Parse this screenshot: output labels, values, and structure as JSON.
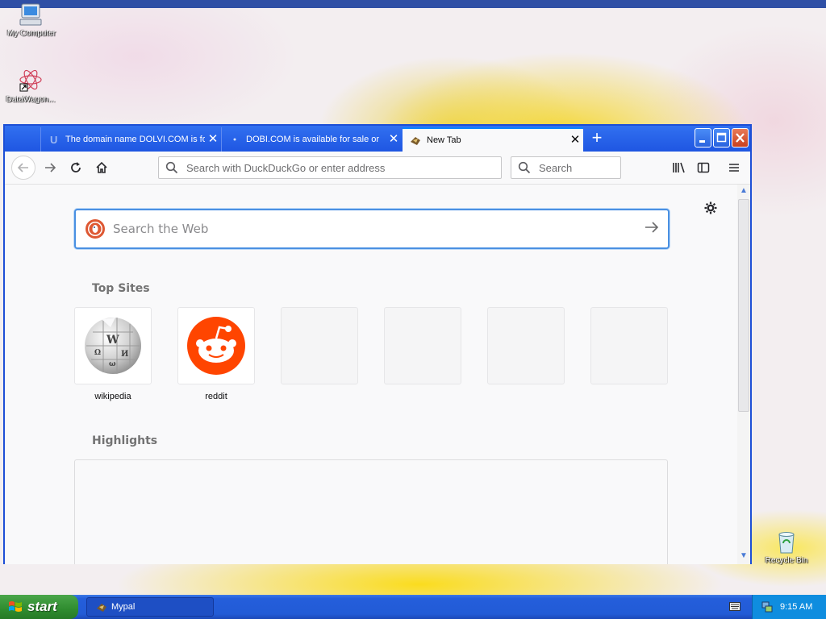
{
  "desktop": {
    "icons": [
      {
        "label": "My Computer",
        "icon": "my-computer-icon"
      },
      {
        "label": "DataWagon...",
        "icon": "datawagon-shortcut-icon"
      },
      {
        "label": "Recycle Bin",
        "icon": "recycle-bin-icon"
      }
    ]
  },
  "browser": {
    "tabs": [
      {
        "title": "The domain name DOLVI.COM is fo",
        "active": false
      },
      {
        "title": "DOBI.COM is available for sale or",
        "active": false
      },
      {
        "title": "New Tab",
        "active": true
      }
    ],
    "urlbar_placeholder": "Search with DuckDuckGo or enter address",
    "searchbar_placeholder": "Search",
    "newtab": {
      "search_placeholder": "Search the Web",
      "top_sites_title": "Top Sites",
      "top_sites": [
        {
          "label": "wikipedia",
          "icon": "wikipedia-globe-icon"
        },
        {
          "label": "reddit",
          "icon": "reddit-alien-icon"
        },
        {
          "label": ""
        },
        {
          "label": ""
        },
        {
          "label": ""
        },
        {
          "label": ""
        }
      ],
      "highlights_title": "Highlights"
    }
  },
  "taskbar": {
    "start_label": "start",
    "tasks": [
      {
        "label": "Mypal",
        "icon": "mypal-icon"
      }
    ],
    "clock": "9:15 AM"
  },
  "colors": {
    "xp_blue": "#245edb",
    "window_border": "#1d4fd6",
    "start_green": "#2f8c2f",
    "reddit_orange": "#ff4500",
    "ddg_orange": "#de5833",
    "focus_blue": "#4a90e2"
  }
}
